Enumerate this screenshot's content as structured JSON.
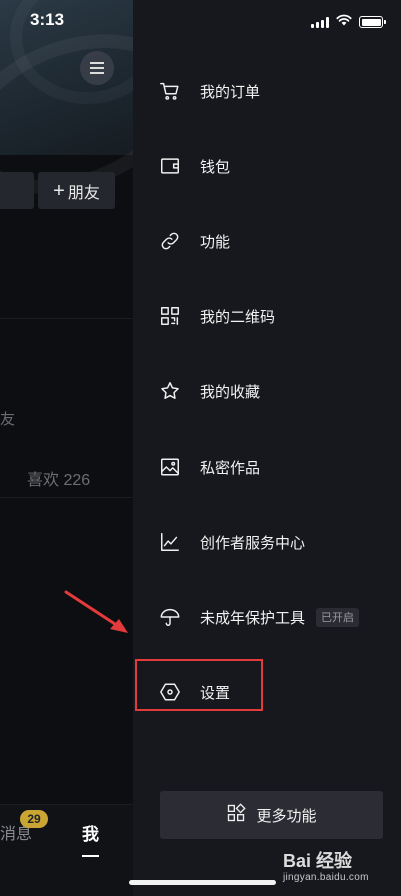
{
  "status_bar": {
    "time": "3:13"
  },
  "left_page": {
    "add_friend_plus": "+",
    "add_friend_label": "朋友",
    "tab_fragment": "友",
    "likes_tab": "喜欢 226",
    "bottom_nav": {
      "messages": "消息",
      "messages_badge": "29",
      "me": "我"
    }
  },
  "drawer": {
    "items": [
      {
        "label": "我的订单",
        "icon": "cart-icon"
      },
      {
        "label": "钱包",
        "icon": "wallet-icon"
      },
      {
        "label": "功能",
        "icon": "link-icon"
      },
      {
        "label": "我的二维码",
        "icon": "qr-code-icon"
      },
      {
        "label": "我的收藏",
        "icon": "star-icon"
      },
      {
        "label": "私密作品",
        "icon": "image-icon"
      },
      {
        "label": "创作者服务中心",
        "icon": "chart-icon"
      },
      {
        "label": "未成年保护工具",
        "icon": "umbrella-icon",
        "badge": "已开启"
      },
      {
        "label": "设置",
        "icon": "settings-hexagon-icon"
      }
    ],
    "more_button": {
      "label": "更多功能",
      "icon": "grid-icon"
    }
  },
  "annotation": {
    "highlight_color": "#e33b3b"
  },
  "watermark": {
    "text": "Bai 经验",
    "sub": "jingyan.baidu.com"
  }
}
